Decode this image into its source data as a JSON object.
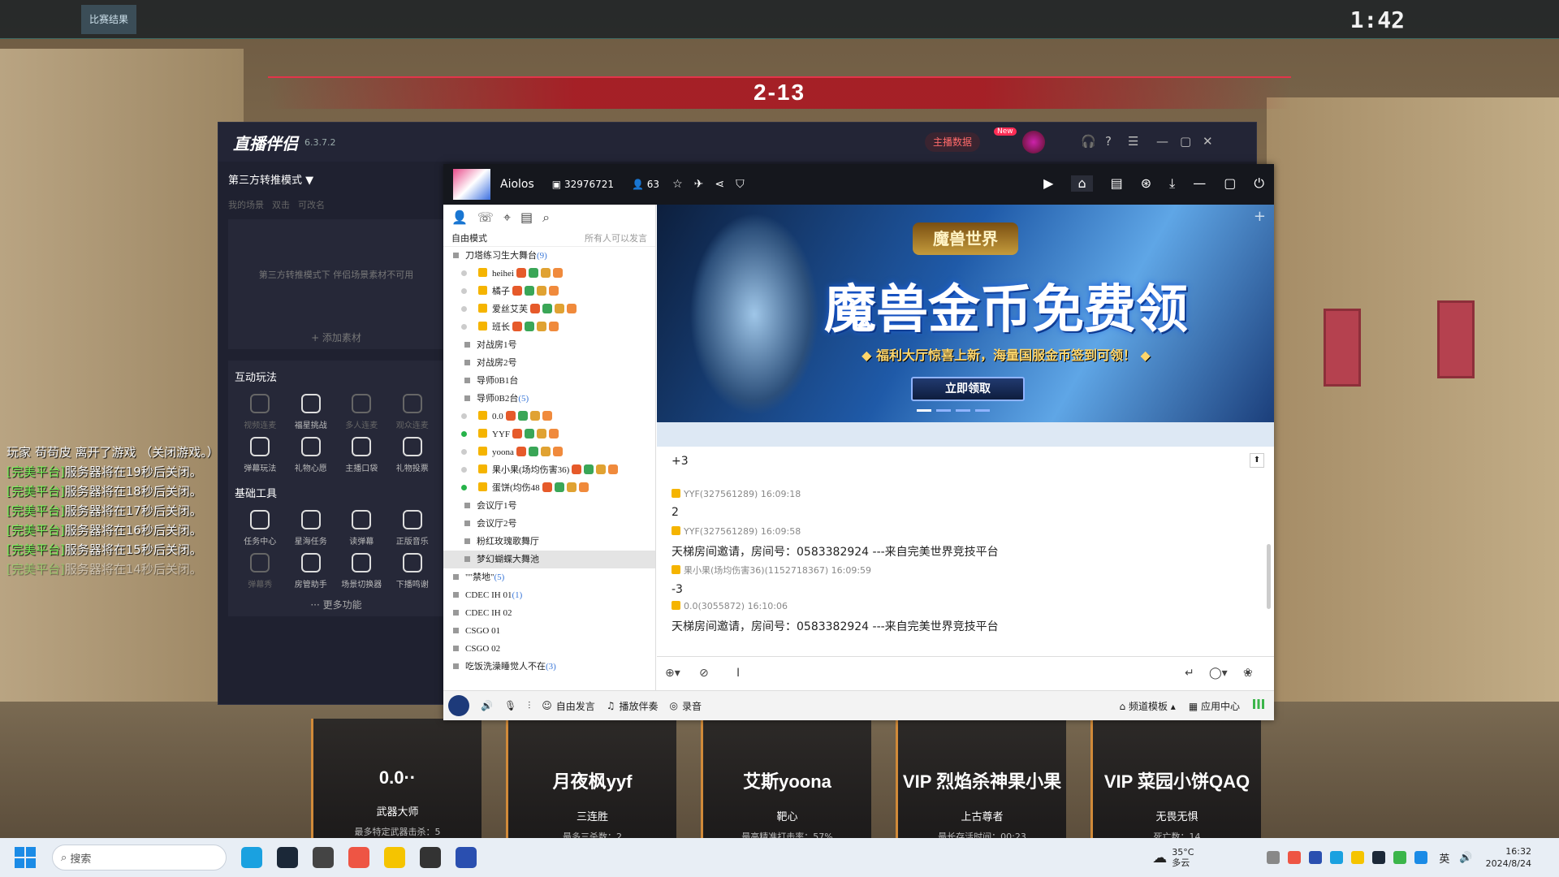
{
  "hud": {
    "match_result_label": "比赛结果",
    "timer": "1:42",
    "score": "2-13"
  },
  "killfeed": {
    "left_line": "玩家 苟苟皮 离开了游戏 （关闭游戏。）",
    "platform_tag": "[完美平台]",
    "lines": [
      "服务器将在19秒后关闭。",
      "服务器将在18秒后关闭。",
      "服务器将在17秒后关闭。",
      "服务器将在16秒后关闭。",
      "服务器将在15秒后关闭。",
      "服务器将在14秒后关闭。"
    ]
  },
  "player_cards": [
    {
      "name": "0.0··",
      "role": "武器大师",
      "stat": "最多特定武器击杀：5"
    },
    {
      "name": "月夜枫yyf",
      "role": "三连胜",
      "stat": "最多三杀数：2"
    },
    {
      "name": "艾斯yoona",
      "role": "靶心",
      "stat": "最高精准打击率：57%"
    },
    {
      "name": "VIP 烈焰杀神果小果",
      "role": "上古尊者",
      "stat": "最长存活时间：00:23"
    },
    {
      "name": "VIP 菜园小饼QAQ",
      "role": "无畏无惧",
      "stat": "死亡数：14"
    }
  ],
  "zbbl": {
    "logo": "直播伴侣",
    "version": "6.3.7.2",
    "data_btn": "主播数据",
    "new_badge": "New",
    "mode": "第三方转推模式 ▼",
    "scene_tabs": [
      "我的场景",
      "双击",
      "可改名"
    ],
    "scene_empty": "第三方转推模式下 伴侣场景素材不可用",
    "add_material": "+ 添加素材",
    "interactive_title": "互动玩法",
    "interactive_items": [
      {
        "label": "视频连麦",
        "dim": true
      },
      {
        "label": "福星挑战",
        "dim": false
      },
      {
        "label": "多人连麦",
        "dim": true
      },
      {
        "label": "观众连麦",
        "dim": true
      },
      {
        "label": "弹幕玩法",
        "dim": false
      },
      {
        "label": "礼物心愿",
        "dim": false
      },
      {
        "label": "主播口袋",
        "dim": false
      },
      {
        "label": "礼物投票",
        "dim": false
      }
    ],
    "tools_title": "基础工具",
    "tools_items": [
      {
        "label": "任务中心",
        "dim": false
      },
      {
        "label": "星海任务",
        "dim": false
      },
      {
        "label": "读弹幕",
        "dim": false
      },
      {
        "label": "正版音乐",
        "dim": false
      },
      {
        "label": "弹幕秀",
        "dim": true
      },
      {
        "label": "房管助手",
        "dim": false
      },
      {
        "label": "场景切换器",
        "dim": false
      },
      {
        "label": "下播鸣谢",
        "dim": false
      }
    ],
    "more": "··· 更多功能"
  },
  "yy": {
    "channel_name": "Aiolos",
    "channel_id": "32976721",
    "online_count": "63",
    "tree_mode": "自由模式",
    "tree_mode_right": "所有人可以发言",
    "tree": [
      {
        "t": "group",
        "label": "刀塔练习生大舞台",
        "cnt": "(9)"
      },
      {
        "t": "user",
        "label": "heihei",
        "on": false
      },
      {
        "t": "user",
        "label": "橘子",
        "on": false
      },
      {
        "t": "user",
        "label": "爱丝艾芙",
        "on": false
      },
      {
        "t": "user",
        "label": "班长",
        "on": false
      },
      {
        "t": "sub",
        "label": "对战房1号"
      },
      {
        "t": "sub",
        "label": "对战房2号"
      },
      {
        "t": "sub",
        "label": "导师0B1台"
      },
      {
        "t": "sub",
        "label": "导师0B2台",
        "cnt": "(5)"
      },
      {
        "t": "user",
        "label": "0.0",
        "on": false
      },
      {
        "t": "user",
        "label": "YYF",
        "on": true
      },
      {
        "t": "user",
        "label": "yoona",
        "on": false
      },
      {
        "t": "user",
        "label": "果小果(场均伤害36)",
        "on": false
      },
      {
        "t": "user",
        "label": "蛋饼(均伤48",
        "on": true
      },
      {
        "t": "sub",
        "label": "会议厅1号"
      },
      {
        "t": "sub",
        "label": "会议厅2号"
      },
      {
        "t": "sub",
        "label": "粉红玫瑰歌舞厅"
      },
      {
        "t": "sub",
        "label": "梦幻蝴蝶大舞池",
        "sel": true
      },
      {
        "t": "group",
        "label": "\"\"禁地\"",
        "cnt": "(5)"
      },
      {
        "t": "group",
        "label": "CDEC IH 01",
        "cnt": "(1)"
      },
      {
        "t": "group",
        "label": "CDEC IH 02"
      },
      {
        "t": "group",
        "label": "CSGO 01"
      },
      {
        "t": "group",
        "label": "CSGO 02"
      },
      {
        "t": "group",
        "label": "吃饭洗澡睡觉人不在",
        "cnt": "(3)"
      }
    ],
    "banner": {
      "logo": "魔兽世界",
      "title": "魔兽金币免费领",
      "subtitle": "◆ 福利大厅惊喜上新，海量国服金币签到可领！ ◆",
      "button": "立即领取"
    },
    "chat": [
      {
        "meta": "",
        "text": "+3"
      },
      {
        "meta": "YYF(327561289)  16:09:18",
        "text": "2"
      },
      {
        "meta": "YYF(327561289)  16:09:58",
        "text": "天梯房间邀请，房间号：0583382924 ---来自完美世界竞技平台"
      },
      {
        "meta": "果小果(场均伤害36)(1152718367)  16:09:59",
        "text": "-3"
      },
      {
        "meta": "0.0(3055872)  16:10:06",
        "text": "天梯房间邀请，房间号：0583382924 ---来自完美世界竞技平台"
      }
    ],
    "bottom": {
      "free_speak": "自由发言",
      "accompany": "播放伴奏",
      "record": "录音",
      "template": "频道模板",
      "app_center": "应用中心"
    }
  },
  "taskbar": {
    "search": "搜索",
    "weather_temp": "35°C",
    "weather_desc": "多云",
    "ime": "英",
    "time": "16:32",
    "date": "2024/8/24"
  },
  "colors": {
    "accent_red": "#e3344a",
    "killfeed_green": "#7cf05b",
    "tree_count_blue": "#3a77d8"
  }
}
